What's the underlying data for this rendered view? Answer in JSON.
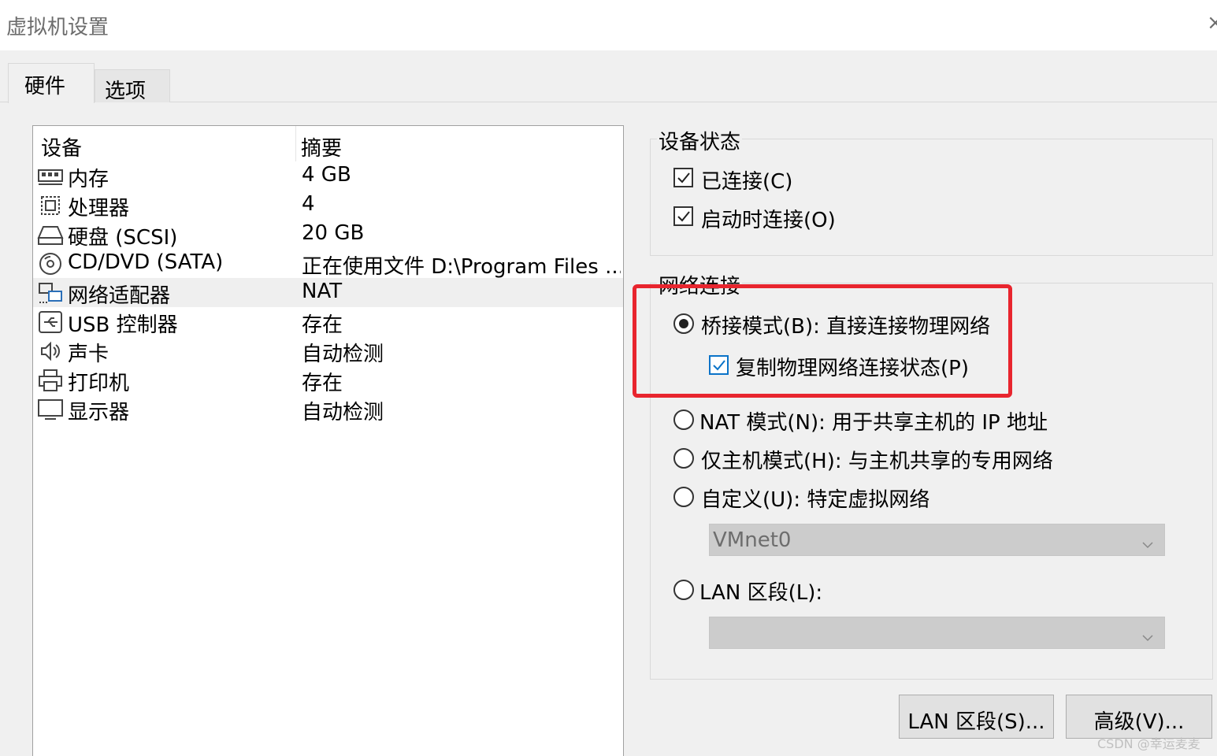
{
  "window": {
    "title": "虚拟机设置",
    "close_glyph": "×"
  },
  "tabs": [
    {
      "label": "硬件"
    },
    {
      "label": "选项"
    }
  ],
  "device_list": {
    "headers": {
      "device": "设备",
      "summary": "摘要"
    },
    "rows": [
      {
        "icon": "memory-icon",
        "name": "内存",
        "summary": "4 GB"
      },
      {
        "icon": "processor-icon",
        "name": "处理器",
        "summary": "4"
      },
      {
        "icon": "hard-disk-icon",
        "name": "硬盘 (SCSI)",
        "summary": "20 GB"
      },
      {
        "icon": "cd-dvd-icon",
        "name": "CD/DVD (SATA)",
        "summary": "正在使用文件 D:\\Program Files ..."
      },
      {
        "icon": "network-adapter-icon",
        "name": "网络适配器",
        "summary": "NAT"
      },
      {
        "icon": "usb-icon",
        "name": "USB 控制器",
        "summary": "存在"
      },
      {
        "icon": "sound-icon",
        "name": "声卡",
        "summary": "自动检测"
      },
      {
        "icon": "printer-icon",
        "name": "打印机",
        "summary": "存在"
      },
      {
        "icon": "display-icon",
        "name": "显示器",
        "summary": "自动检测"
      }
    ]
  },
  "device_status": {
    "legend": "设备状态",
    "connected": {
      "label": "已连接(C)",
      "checked": true
    },
    "connect_at_power_on": {
      "label": "启动时连接(O)",
      "checked": true
    }
  },
  "network_connection": {
    "legend": "网络连接",
    "bridged": {
      "label": "桥接模式(B): 直接连接物理网络",
      "selected": true
    },
    "replicate_state": {
      "label": "复制物理网络连接状态(P)",
      "checked": true
    },
    "nat": {
      "label": "NAT 模式(N): 用于共享主机的 IP 地址",
      "selected": false
    },
    "host_only": {
      "label": "仅主机模式(H): 与主机共享的专用网络",
      "selected": false
    },
    "custom": {
      "label": "自定义(U): 特定虚拟网络",
      "selected": false
    },
    "custom_select_value": "VMnet0",
    "lan_segment": {
      "label": "LAN 区段(L):",
      "selected": false
    },
    "lan_select_value": ""
  },
  "buttons": {
    "lan_segments": "LAN 区段(S)...",
    "advanced": "高级(V)..."
  },
  "watermark": "CSDN @幸运麦麦",
  "colors": {
    "highlight": "#e8252e",
    "checkbox_accent": "#0b73c8"
  }
}
